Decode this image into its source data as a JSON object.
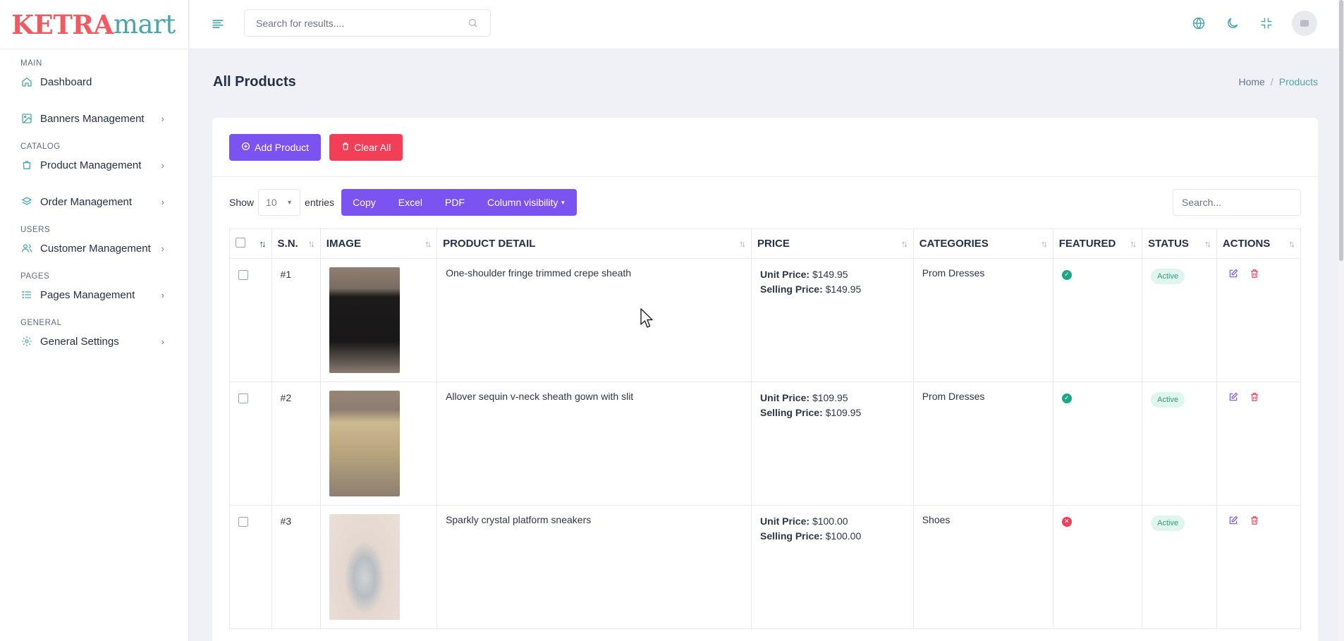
{
  "brand": {
    "part1": "KETRA",
    "part2": "mart"
  },
  "header": {
    "search_placeholder": "Search for results....",
    "icons": [
      "menu-icon",
      "search-icon",
      "globe-icon",
      "moon-icon",
      "fullscreen-exit-icon",
      "avatar-image-icon"
    ]
  },
  "sidebar": {
    "sections": [
      {
        "title": "MAIN",
        "items": [
          {
            "label": "Dashboard",
            "icon": "home-icon",
            "has_children": false
          },
          {
            "label": "Banners Management",
            "icon": "image-icon",
            "has_children": true
          }
        ]
      },
      {
        "title": "CATALOG",
        "items": [
          {
            "label": "Product Management",
            "icon": "shopping-bag-icon",
            "has_children": true
          },
          {
            "label": "Order Management",
            "icon": "layers-icon",
            "has_children": true
          }
        ]
      },
      {
        "title": "USERS",
        "items": [
          {
            "label": "Customer Management",
            "icon": "users-icon",
            "has_children": true
          }
        ]
      },
      {
        "title": "PAGES",
        "items": [
          {
            "label": "Pages Management",
            "icon": "list-icon",
            "has_children": true
          }
        ]
      },
      {
        "title": "GENERAL",
        "items": [
          {
            "label": "General Settings",
            "icon": "settings-icon",
            "has_children": true
          }
        ]
      }
    ]
  },
  "page": {
    "title": "All Products",
    "breadcrumb": {
      "home": "Home",
      "separator": "/",
      "current": "Products"
    }
  },
  "actions": {
    "add_label": "Add Product",
    "clear_label": "Clear All"
  },
  "datatable": {
    "show_label": "Show",
    "length_value": "10",
    "entries_label": "entries",
    "buttons": [
      "Copy",
      "Excel",
      "PDF",
      "Column visibility"
    ],
    "search_placeholder": "Search...",
    "columns": [
      "S.N.",
      "IMAGE",
      "PRODUCT DETAIL",
      "PRICE",
      "CATEGORIES",
      "FEATURED",
      "STATUS",
      "ACTIONS"
    ],
    "unit_price_label": "Unit Price:",
    "selling_price_label": "Selling Price:",
    "rows": [
      {
        "sn": "#1",
        "image": "black one-shoulder dress photo",
        "detail": "One-shoulder fringe trimmed crepe sheath",
        "unit_price": "$149.95",
        "selling_price": "$149.95",
        "category": "Prom Dresses",
        "featured": true,
        "status": "Active"
      },
      {
        "sn": "#2",
        "image": "gold sequin gown photo",
        "detail": "Allover sequin v-neck sheath gown with slit",
        "unit_price": "$109.95",
        "selling_price": "$109.95",
        "category": "Prom Dresses",
        "featured": true,
        "status": "Active"
      },
      {
        "sn": "#3",
        "image": "silver sneaker photo",
        "detail": "Sparkly crystal platform sneakers",
        "unit_price": "$100.00",
        "selling_price": "$100.00",
        "category": "Shoes",
        "featured": false,
        "status": "Active"
      }
    ]
  },
  "colors": {
    "accent": "#4aa6a9",
    "primary": "#7b53f0",
    "danger": "#f23e57",
    "success": "#1aa886",
    "logo_red": "#ef5a63"
  }
}
